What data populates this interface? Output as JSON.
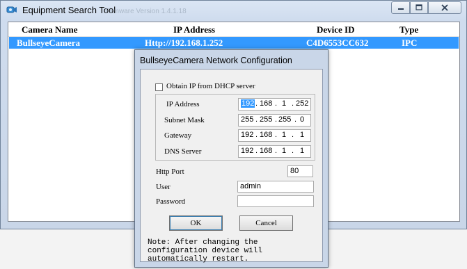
{
  "window": {
    "title": "Equipment Search Tool",
    "ghost_text": "Firmware Version     1.4.1.18"
  },
  "list": {
    "headers": [
      "Camera Name",
      "IP Address",
      "Device ID",
      "Type"
    ],
    "rows": [
      {
        "name": "BullseyeCamera",
        "ip": "Http://192.168.1.252",
        "device_id": "C4D6553CC632",
        "type": "IPC"
      }
    ]
  },
  "dialog": {
    "title": "BullseyeCamera Network Configuration",
    "dhcp_label": "Obtain IP from DHCP server",
    "dhcp_checked": false,
    "ip_fields": [
      {
        "label": "IP Address",
        "octets": [
          "192",
          "168",
          "1",
          "252"
        ]
      },
      {
        "label": "Subnet Mask",
        "octets": [
          "255",
          "255",
          "255",
          "0"
        ]
      },
      {
        "label": "Gateway",
        "octets": [
          "192",
          "168",
          "1",
          "1"
        ]
      },
      {
        "label": "DNS Server",
        "octets": [
          "192",
          "168",
          "1",
          "1"
        ]
      }
    ],
    "http_port_label": "Http Port",
    "http_port_value": "80",
    "user_label": "User",
    "user_value": "admin",
    "password_label": "Password",
    "password_value": "",
    "ok_label": "OK",
    "cancel_label": "Cancel",
    "note": "Note: After changing the configuration device will automatically restart."
  },
  "colors": {
    "selection": "#3399ff",
    "window_frame": "#c9d6e8"
  }
}
